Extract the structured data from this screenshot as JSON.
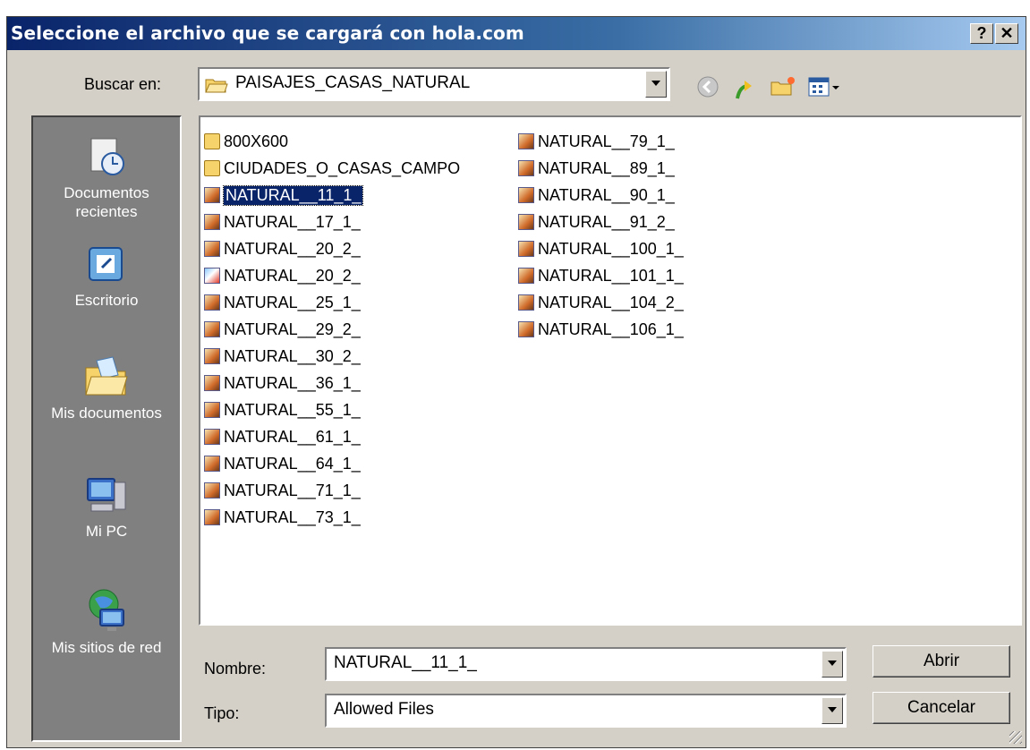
{
  "window": {
    "title": "Seleccione el archivo que se cargará con hola.com"
  },
  "title_buttons": {
    "help": "?",
    "close": "✕"
  },
  "lookin": {
    "label": "Buscar en:",
    "value": "PAISAJES_CASAS_NATURAL"
  },
  "toolbar": {
    "icons": [
      "back-icon",
      "up-folder-icon",
      "new-folder-icon",
      "views-menu-icon"
    ]
  },
  "places": [
    {
      "label": "Documentos recientes",
      "icon": "recent-documents-icon"
    },
    {
      "label": "Escritorio",
      "icon": "desktop-icon"
    },
    {
      "label": "Mis documentos",
      "icon": "my-documents-icon"
    },
    {
      "label": "Mi PC",
      "icon": "my-computer-icon"
    },
    {
      "label": "Mis sitios de red",
      "icon": "network-places-icon"
    }
  ],
  "files": {
    "col1": [
      {
        "name": "800X600",
        "type": "folder"
      },
      {
        "name": "CIUDADES_O_CASAS_CAMPO",
        "type": "folder"
      },
      {
        "name": "NATURAL__11_1_",
        "type": "image",
        "selected": true
      },
      {
        "name": "NATURAL__17_1_",
        "type": "image"
      },
      {
        "name": "NATURAL__20_2_",
        "type": "image"
      },
      {
        "name": "NATURAL__20_2_",
        "type": "image2"
      },
      {
        "name": "NATURAL__25_1_",
        "type": "image"
      },
      {
        "name": "NATURAL__29_2_",
        "type": "image"
      },
      {
        "name": "NATURAL__30_2_",
        "type": "image"
      },
      {
        "name": "NATURAL__36_1_",
        "type": "image"
      },
      {
        "name": "NATURAL__55_1_",
        "type": "image"
      },
      {
        "name": "NATURAL__61_1_",
        "type": "image"
      },
      {
        "name": "NATURAL__64_1_",
        "type": "image"
      },
      {
        "name": "NATURAL__71_1_",
        "type": "image"
      },
      {
        "name": "NATURAL__73_1_",
        "type": "image"
      }
    ],
    "col2": [
      {
        "name": "NATURAL__79_1_",
        "type": "image"
      },
      {
        "name": "NATURAL__89_1_",
        "type": "image"
      },
      {
        "name": "NATURAL__90_1_",
        "type": "image"
      },
      {
        "name": "NATURAL__91_2_",
        "type": "image"
      },
      {
        "name": "NATURAL__100_1_",
        "type": "image"
      },
      {
        "name": "NATURAL__101_1_",
        "type": "image"
      },
      {
        "name": "NATURAL__104_2_",
        "type": "image"
      },
      {
        "name": "NATURAL__106_1_",
        "type": "image"
      }
    ]
  },
  "filename": {
    "label": "Nombre:",
    "value": "NATURAL__11_1_"
  },
  "filetype": {
    "label": "Tipo:",
    "value": "Allowed Files"
  },
  "buttons": {
    "open": "Abrir",
    "cancel": "Cancelar"
  },
  "colors": {
    "title_start": "#0a246a",
    "title_end": "#a6caf0",
    "face": "#d4d0c8",
    "selection": "#0a246a"
  }
}
